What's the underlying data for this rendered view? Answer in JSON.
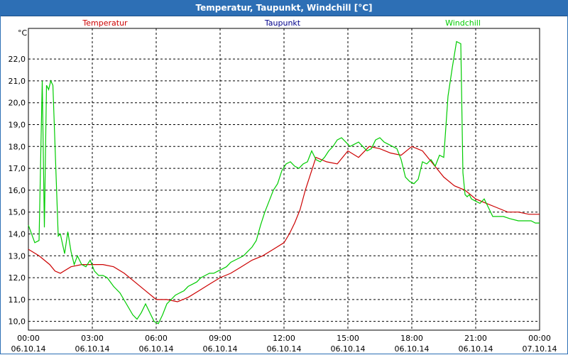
{
  "window": {
    "title": "Temperatur, Taupunkt, Windchill [°C]"
  },
  "chart_data": {
    "type": "line",
    "title": "Temperatur, Taupunkt, Windchill [°C]",
    "ylabel": "°C",
    "ylim": [
      9.6,
      23.4
    ],
    "yticks": [
      "10,0",
      "11,0",
      "12,0",
      "13,0",
      "14,0",
      "15,0",
      "16,0",
      "17,0",
      "18,0",
      "19,0",
      "20,0",
      "21,0",
      "22,0"
    ],
    "xlim": [
      0,
      24
    ],
    "xticks": [
      {
        "time": "00:00",
        "date": "06.10.14"
      },
      {
        "time": "03:00",
        "date": "06.10.14"
      },
      {
        "time": "06:00",
        "date": "06.10.14"
      },
      {
        "time": "09:00",
        "date": "06.10.14"
      },
      {
        "time": "12:00",
        "date": "06.10.14"
      },
      {
        "time": "15:00",
        "date": "06.10.14"
      },
      {
        "time": "18:00",
        "date": "06.10.14"
      },
      {
        "time": "21:00",
        "date": "06.10.14"
      },
      {
        "time": "00:00",
        "date": "07.10.14"
      }
    ],
    "grid": true,
    "legend_position": "top",
    "series": [
      {
        "name": "Temperatur",
        "color": "#cc0000",
        "x": [
          0,
          0.5,
          1,
          1.25,
          1.5,
          2,
          2.5,
          3,
          3.5,
          4,
          4.5,
          5,
          5.5,
          6,
          6.5,
          7,
          7.5,
          8,
          8.5,
          9,
          9.5,
          10,
          10.5,
          11,
          11.5,
          12,
          12.25,
          12.5,
          12.75,
          13,
          13.5,
          14,
          14.5,
          15,
          15.5,
          16,
          16.5,
          17,
          17.5,
          18,
          18.5,
          19,
          19.5,
          20,
          20.5,
          21,
          21.5,
          22,
          22.5,
          23,
          23.5,
          24
        ],
        "y": [
          13.3,
          13.0,
          12.6,
          12.3,
          12.2,
          12.5,
          12.6,
          12.6,
          12.6,
          12.5,
          12.2,
          11.8,
          11.4,
          11.0,
          11.0,
          10.9,
          11.1,
          11.4,
          11.7,
          12.0,
          12.2,
          12.5,
          12.8,
          13.0,
          13.3,
          13.6,
          14.0,
          14.5,
          15.1,
          16.0,
          17.5,
          17.3,
          17.2,
          17.8,
          17.5,
          18.0,
          17.9,
          17.7,
          17.6,
          18.0,
          17.8,
          17.2,
          16.6,
          16.2,
          16.0,
          15.6,
          15.4,
          15.2,
          15.0,
          15.0,
          14.9,
          14.9
        ]
      },
      {
        "name": "Taupunkt",
        "color": "#00008b",
        "x": [],
        "y": []
      },
      {
        "name": "Windchill",
        "color": "#00cc00",
        "x": [
          0,
          0.3,
          0.5,
          0.65,
          0.75,
          0.85,
          0.95,
          1.05,
          1.15,
          1.4,
          1.5,
          1.7,
          1.85,
          2,
          2.15,
          2.3,
          2.5,
          2.7,
          2.9,
          3.1,
          3.3,
          3.5,
          3.7,
          4,
          4.3,
          4.6,
          4.9,
          5.1,
          5.3,
          5.5,
          5.7,
          5.9,
          6.1,
          6.3,
          6.5,
          6.7,
          6.9,
          7.1,
          7.3,
          7.5,
          7.7,
          7.9,
          8.1,
          8.3,
          8.5,
          8.7,
          8.9,
          9.1,
          9.3,
          9.5,
          9.7,
          9.9,
          10.1,
          10.3,
          10.5,
          10.7,
          10.9,
          11.1,
          11.3,
          11.5,
          11.7,
          11.9,
          12.1,
          12.3,
          12.5,
          12.7,
          12.9,
          13.1,
          13.3,
          13.5,
          13.7,
          13.9,
          14.1,
          14.3,
          14.5,
          14.7,
          14.9,
          15.1,
          15.3,
          15.5,
          15.7,
          15.9,
          16.1,
          16.3,
          16.5,
          16.7,
          16.9,
          17.1,
          17.3,
          17.5,
          17.7,
          17.9,
          18.1,
          18.3,
          18.5,
          18.7,
          18.9,
          19.1,
          19.3,
          19.5,
          19.7,
          19.9,
          20.1,
          20.3,
          20.4,
          20.5,
          20.6,
          20.7,
          20.8,
          21,
          21.2,
          21.4,
          21.6,
          21.8,
          22,
          22.3,
          22.6,
          23,
          23.3,
          23.6,
          23.8,
          24
        ],
        "y": [
          14.4,
          13.6,
          13.7,
          21.0,
          14.3,
          20.8,
          20.6,
          21.0,
          20.8,
          13.9,
          14.0,
          13.1,
          14.1,
          13.2,
          12.6,
          13.0,
          12.6,
          12.5,
          12.8,
          12.3,
          12.1,
          12.1,
          12.0,
          11.6,
          11.3,
          10.8,
          10.3,
          10.1,
          10.4,
          10.8,
          10.4,
          10.0,
          9.9,
          10.3,
          10.8,
          11.0,
          11.2,
          11.3,
          11.4,
          11.6,
          11.7,
          11.8,
          12.0,
          12.1,
          12.2,
          12.2,
          12.3,
          12.4,
          12.5,
          12.7,
          12.8,
          12.9,
          13.0,
          13.2,
          13.4,
          13.7,
          14.4,
          15.0,
          15.5,
          16.0,
          16.3,
          16.9,
          17.2,
          17.3,
          17.1,
          17.0,
          17.2,
          17.3,
          17.8,
          17.4,
          17.3,
          17.5,
          17.8,
          18.0,
          18.3,
          18.4,
          18.2,
          18.0,
          18.1,
          18.2,
          18.0,
          17.8,
          17.9,
          18.3,
          18.4,
          18.2,
          18.1,
          18.0,
          17.9,
          17.4,
          16.6,
          16.4,
          16.3,
          16.5,
          17.3,
          17.2,
          17.4,
          17.1,
          17.6,
          17.5,
          20.3,
          21.6,
          22.8,
          22.7,
          16.8,
          15.8,
          15.7,
          15.8,
          15.6,
          15.5,
          15.4,
          15.6,
          15.2,
          14.8,
          14.8,
          14.8,
          14.7,
          14.6,
          14.6,
          14.6,
          14.5,
          14.5
        ]
      }
    ]
  }
}
